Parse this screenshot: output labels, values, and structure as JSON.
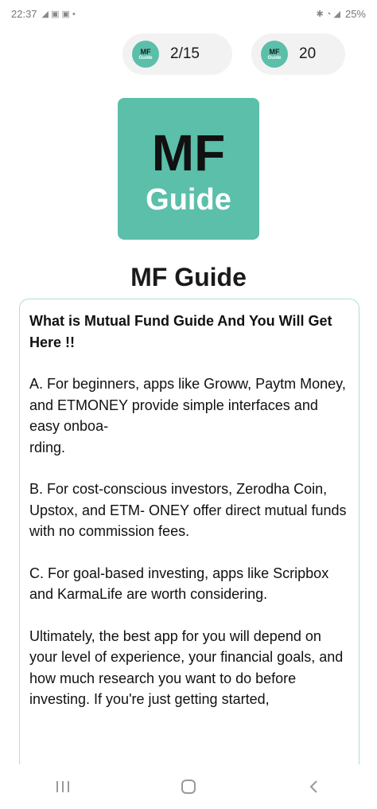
{
  "status_bar": {
    "time": "22:37",
    "left_extras": "◢ ▣ ▣ •",
    "right_extras": "✱ ◔ ◢",
    "battery": "25%"
  },
  "badges": {
    "progress": {
      "icon_top": "MF",
      "icon_bottom": "Guide",
      "value": "2/15"
    },
    "count": {
      "icon_top": "MF",
      "icon_bottom": "Guide",
      "value": "20"
    }
  },
  "logo": {
    "line1": "MF",
    "line2": "Guide"
  },
  "title": "MF Guide",
  "content": {
    "heading": "What is Mutual Fund Guide And You Will Get Here !!",
    "paragraphs": [
      "A. For beginners, apps like Groww, Paytm Money, and ETMONEY provide simple interfaces and easy onboa-\nrding.",
      "B. For cost-conscious investors, Zerodha Coin, Upstox, and ETM- ONEY offer direct mutual funds with no commission fees.",
      "C. For goal-based investing, apps like Scripbox and KarmaLife are worth considering.",
      "Ultimately, the best app for you will depend on your level of experience, your financial goals, and how much research you want to do before investing. If you're just getting started,"
    ]
  },
  "nav": {
    "recents_icon": "recents-icon",
    "home_icon": "home-icon",
    "back_icon": "back-icon"
  },
  "colors": {
    "accent": "#5bbfaa",
    "card_border": "#aee0d3",
    "badge_bg": "#f2f2f2"
  }
}
